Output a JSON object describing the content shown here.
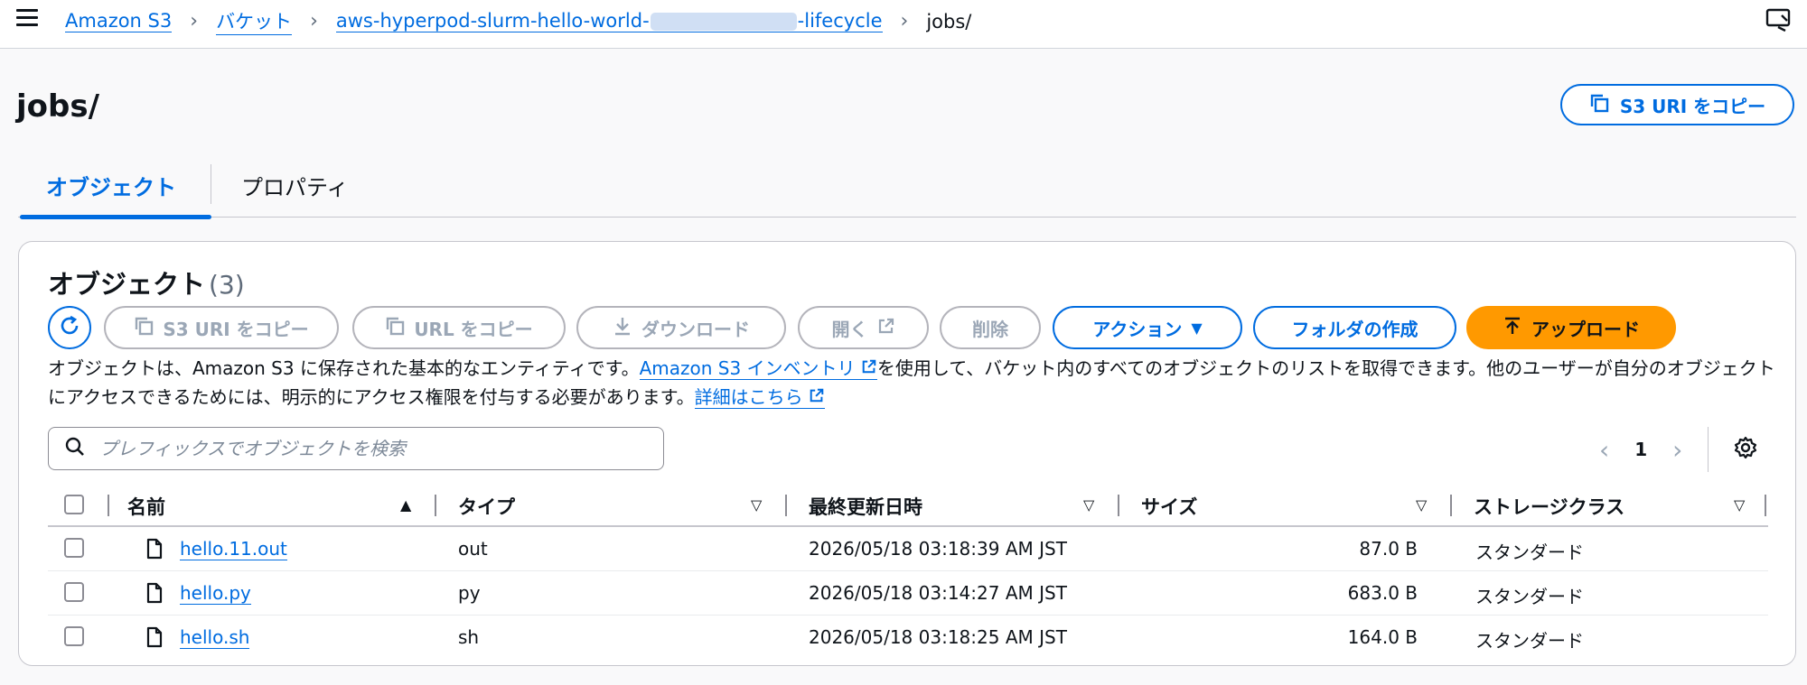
{
  "breadcrumb": {
    "items": [
      "Amazon S3",
      "バケット",
      "aws-hyperpod-slurm-hello-world-",
      "-lifecycle",
      "jobs/"
    ]
  },
  "header": {
    "title": "jobs/",
    "copy_uri_label": "S3 URI をコピー"
  },
  "tabs": [
    {
      "label": "オブジェクト",
      "active": true
    },
    {
      "label": "プロパティ",
      "active": false
    }
  ],
  "panel": {
    "title": "オブジェクト",
    "count": "(3)",
    "toolbar": {
      "copy_s3_uri": "S3 URI をコピー",
      "copy_url": "URL をコピー",
      "download": "ダウンロード",
      "open": "開く",
      "delete": "削除",
      "actions": "アクション",
      "create_folder": "フォルダの作成",
      "upload": "アップロード"
    },
    "description": {
      "part1": "オブジェクトは、Amazon S3 に保存された基本的なエンティティです。",
      "link1": "Amazon S3 インベントリ",
      "part2": "を使用して、バケット内のすべてのオブジェクトのリストを取得できます。他のユーザーが自分のオブジェクトにアクセスできるためには、明示的にアクセス権限を付与する必要があります。",
      "link2": "詳細はこちら"
    },
    "search_placeholder": "プレフィックスでオブジェクトを検索",
    "page": "1"
  },
  "table": {
    "columns": [
      "名前",
      "タイプ",
      "最終更新日時",
      "サイズ",
      "ストレージクラス"
    ],
    "rows": [
      {
        "name": "hello.11.out",
        "type": "out",
        "modified": "2026/05/18 03:18:39 AM JST",
        "size": "87.0 B",
        "storage": "スタンダード"
      },
      {
        "name": "hello.py",
        "type": "py",
        "modified": "2026/05/18 03:14:27 AM JST",
        "size": "683.0 B",
        "storage": "スタンダード"
      },
      {
        "name": "hello.sh",
        "type": "sh",
        "modified": "2026/05/18 03:18:25 AM JST",
        "size": "164.0 B",
        "storage": "スタンダード"
      }
    ]
  },
  "colors": {
    "accent": "#006ce0",
    "upload": "#ff9900"
  }
}
